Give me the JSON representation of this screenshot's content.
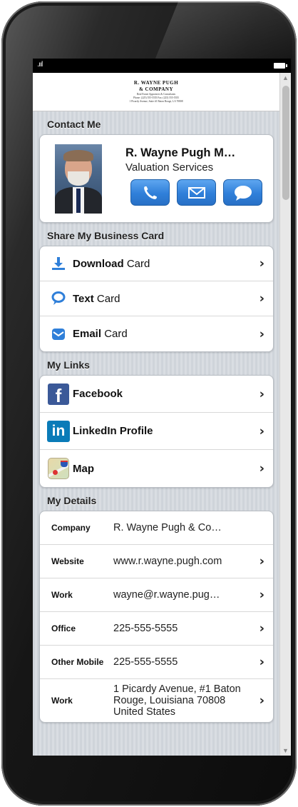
{
  "header": {
    "logo_title_line1": "R. WAYNE PUGH",
    "logo_title_line2": "& COMPANY",
    "logo_sub_line1": "Real Estate Appraisers & Consultants",
    "logo_sub_line2": "Phone: (225) 555-5555  Fax: (225) 555-5555",
    "logo_sub_line3": "1 Picardy Avenue, Suite #1  Baton Rouge, LA  70808"
  },
  "contact": {
    "section_title": "Contact Me",
    "name": "R. Wayne Pugh M…",
    "role": "Valuation Services",
    "actions": [
      {
        "name": "call",
        "icon": "phone-icon"
      },
      {
        "name": "email",
        "icon": "envelope-icon"
      },
      {
        "name": "message",
        "icon": "chat-bubble-icon"
      }
    ]
  },
  "share": {
    "section_title": "Share My Business Card",
    "items": [
      {
        "bold": "Download",
        "rest": " Card",
        "icon": "download-icon"
      },
      {
        "bold": "Text",
        "rest": " Card",
        "icon": "speech-bubble-icon"
      },
      {
        "bold": "Email",
        "rest": " Card",
        "icon": "envelope-icon"
      }
    ]
  },
  "links": {
    "section_title": "My Links",
    "items": [
      {
        "label": "Facebook",
        "icon": "facebook-icon"
      },
      {
        "label": "LinkedIn Profile",
        "icon": "linkedin-icon"
      },
      {
        "label": "Map",
        "icon": "map-icon"
      }
    ]
  },
  "details": {
    "section_title": "My Details",
    "rows": [
      {
        "key": "Company",
        "value": "R. Wayne Pugh & Co…"
      },
      {
        "key": "Website",
        "value": "www.r.wayne.pugh.com"
      },
      {
        "key": "Work",
        "value": "wayne@r.wayne.pug…"
      },
      {
        "key": "Office",
        "value": "225-555-5555"
      },
      {
        "key": "Other Mobile",
        "value": "225-555-5555"
      },
      {
        "key": "Work",
        "value": "1 Picardy Avenue, #1 Baton Rouge, Louisiana 70808 United States"
      }
    ]
  },
  "colors": {
    "accent_blue": "#2f7fd9",
    "facebook_blue": "#3b5998",
    "linkedin_blue": "#0a7bb8"
  }
}
